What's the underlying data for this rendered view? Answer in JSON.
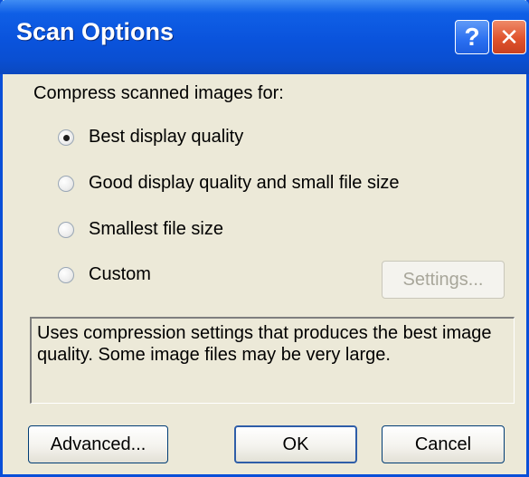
{
  "window": {
    "title": "Scan Options",
    "help_label": "?",
    "close_label": "✕"
  },
  "compress_label": "Compress scanned images for:",
  "options": [
    {
      "label": "Best display quality",
      "selected": true
    },
    {
      "label": "Good display quality and small file size",
      "selected": false
    },
    {
      "label": "Smallest file size",
      "selected": false
    },
    {
      "label": "Custom",
      "selected": false
    }
  ],
  "settings_button": "Settings...",
  "description": "Uses compression settings that produces the best image quality. Some image files may be very large.",
  "buttons": {
    "advanced": "Advanced...",
    "ok": "OK",
    "cancel": "Cancel"
  }
}
